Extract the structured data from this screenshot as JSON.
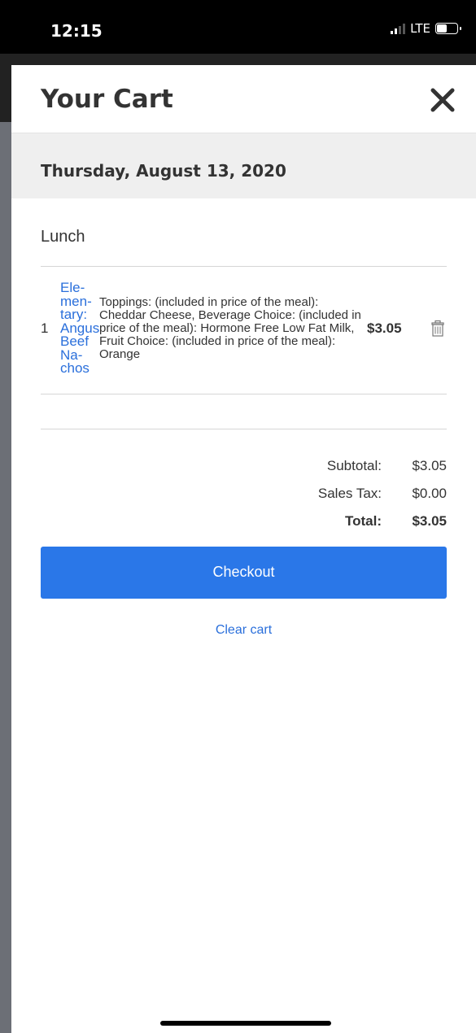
{
  "status_bar": {
    "time": "12:15",
    "network": "LTE"
  },
  "modal": {
    "title": "Your Cart",
    "close_icon": "close-icon"
  },
  "date": "Thursday, August 13, 2020",
  "meal": "Lunch",
  "items": [
    {
      "qty": "1",
      "name": "Ele-men-tary: Angus Beef Na-chos",
      "description": "Toppings: (included in price of the meal): Cheddar Cheese, Beverage Choice: (included in price of the meal): Hormone Free Low Fat Milk, Fruit Choice: (included in price of the meal): Orange",
      "price": "$3.05",
      "delete_icon": "trash-icon"
    }
  ],
  "totals": {
    "subtotal_label": "Subtotal:",
    "subtotal_value": "$3.05",
    "tax_label": "Sales Tax:",
    "tax_value": "$0.00",
    "total_label": "Total:",
    "total_value": "$3.05"
  },
  "actions": {
    "checkout_label": "Checkout",
    "clear_label": "Clear cart"
  },
  "colors": {
    "accent": "#2a77e8",
    "link": "#2a6fdb"
  }
}
